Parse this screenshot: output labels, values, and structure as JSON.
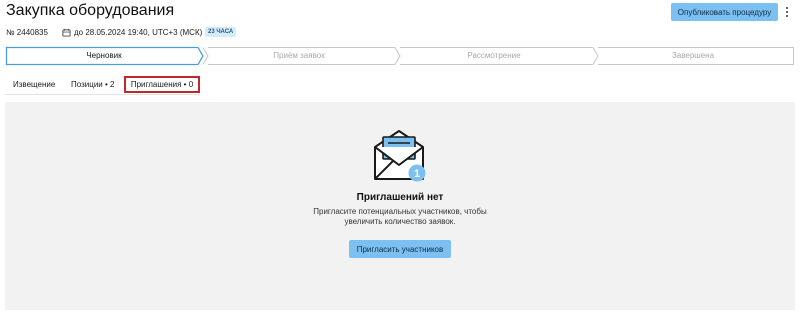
{
  "header": {
    "title": "Закупка оборудования",
    "publish_label": "Опубликовать процедуру",
    "more_icon": "more-vertical-icon"
  },
  "meta": {
    "number": "№ 2440835",
    "calendar_icon": "calendar-icon",
    "deadline": "до 28.05.2024 19:40, UTC+3 (МСК)",
    "badge": "23 ЧАСА"
  },
  "stepper": {
    "steps": [
      {
        "label": "Черновик",
        "state": "active"
      },
      {
        "label": "Приём заявок",
        "state": "inactive"
      },
      {
        "label": "Рассмотрение",
        "state": "inactive"
      },
      {
        "label": "Завершена",
        "state": "inactive"
      }
    ]
  },
  "tabs": [
    {
      "label": "Извещение"
    },
    {
      "label": "Позиции • 2"
    },
    {
      "label": "Приглашения • 0",
      "selected": true
    }
  ],
  "empty_state": {
    "icon": "envelope-icon",
    "icon_badge": "1",
    "title": "Приглашений нет",
    "text_line1": "Пригласите потенциальных участников, чтобы",
    "text_line2": "увеличить количество заявок.",
    "button_label": "Пригласить участников"
  },
  "colors": {
    "accent": "#7cc0f2",
    "tab_highlight": "#c0282d",
    "panel_bg": "#f2f2f2"
  }
}
